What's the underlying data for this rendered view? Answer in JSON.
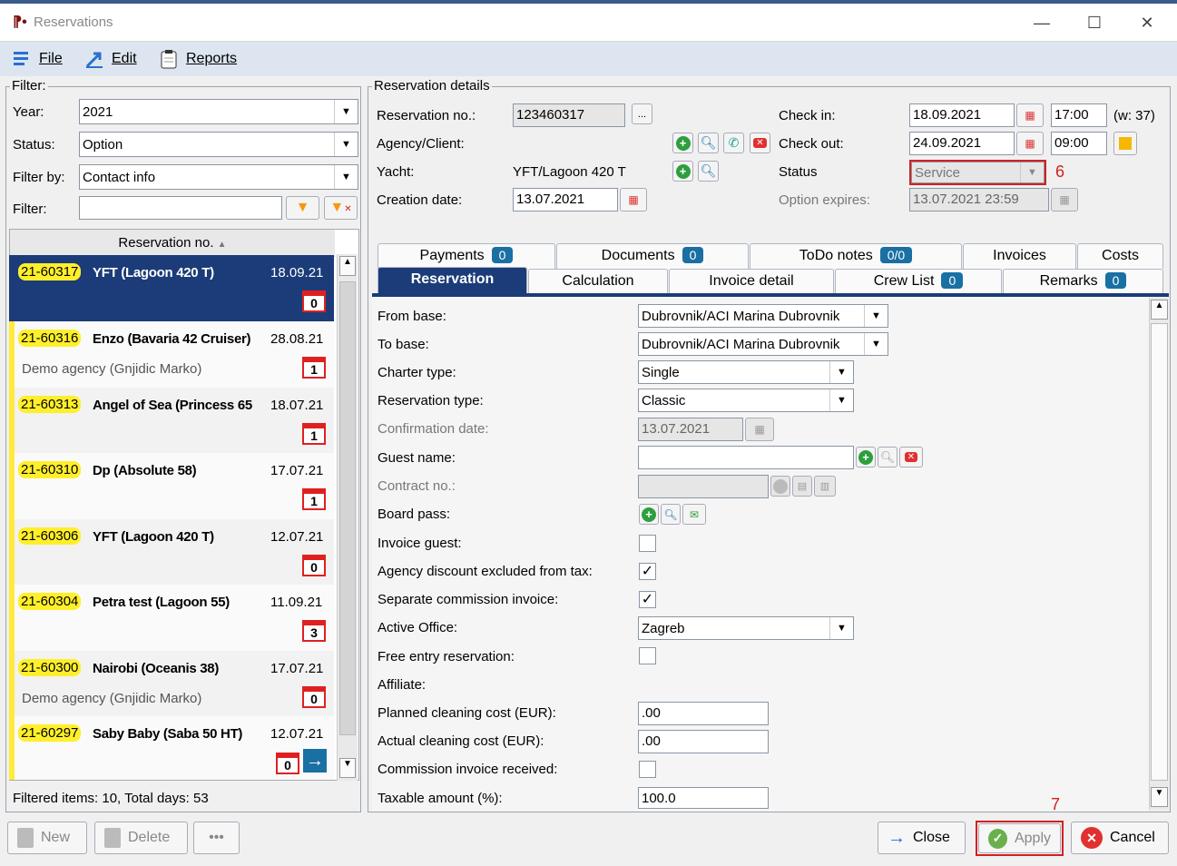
{
  "window": {
    "title": "Reservations"
  },
  "menu": {
    "file": "File",
    "edit": "Edit",
    "reports": "Reports"
  },
  "filter": {
    "group_label": "Filter:",
    "year_label": "Year:",
    "year_value": "2021",
    "status_label": "Status:",
    "status_value": "Option",
    "filterby_label": "Filter by:",
    "filterby_value": "Contact info",
    "filter_label": "Filter:",
    "filter_value": ""
  },
  "list": {
    "column_header": "Reservation no.",
    "items": [
      {
        "no": "21-60317",
        "name": "YFT (Lagoon 420 T)",
        "date": "18.09.21",
        "agency": "",
        "count": "0"
      },
      {
        "no": "21-60316",
        "name": "Enzo (Bavaria 42 Cruiser)",
        "date": "28.08.21",
        "agency": "Demo agency (Gnjidic Marko)",
        "count": "1"
      },
      {
        "no": "21-60313",
        "name": "Angel of Sea (Princess 65",
        "date": "18.07.21",
        "agency": "",
        "count": "1"
      },
      {
        "no": "21-60310",
        "name": "Dp (Absolute 58)",
        "date": "17.07.21",
        "agency": "",
        "count": "1"
      },
      {
        "no": "21-60306",
        "name": "YFT (Lagoon 420 T)",
        "date": "12.07.21",
        "agency": "",
        "count": "0"
      },
      {
        "no": "21-60304",
        "name": "Petra test (Lagoon 55)",
        "date": "11.09.21",
        "agency": "",
        "count": "3"
      },
      {
        "no": "21-60300",
        "name": "Nairobi (Oceanis 38)",
        "date": "17.07.21",
        "agency": "Demo agency (Gnjidic Marko)",
        "count": "0"
      },
      {
        "no": "21-60297",
        "name": "Saby Baby (Saba 50 HT)",
        "date": "12.07.21",
        "agency": "",
        "count": "0"
      }
    ],
    "footer": "Filtered items: 10,  Total days: 53"
  },
  "details": {
    "group_label": "Reservation details",
    "resno_label": "Reservation no.:",
    "resno_value": "123460317",
    "agency_label": "Agency/Client:",
    "yacht_label": "Yacht:",
    "yacht_value": "YFT/Lagoon 420 T",
    "created_label": "Creation date:",
    "created_value": "13.07.2021",
    "checkin_label": "Check in:",
    "checkin_date": "18.09.2021",
    "checkin_time": "17:00",
    "week": "(w: 37)",
    "checkout_label": "Check out:",
    "checkout_date": "24.09.2021",
    "checkout_time": "09:00",
    "status_label": "Status",
    "status_value": "Service",
    "option_label": "Option expires:",
    "option_value": "13.07.2021 23:59"
  },
  "tabs_top": [
    {
      "label": "Payments",
      "badge": "0"
    },
    {
      "label": "Documents",
      "badge": "0"
    },
    {
      "label": "ToDo notes",
      "badge": "0/0"
    },
    {
      "label": "Invoices",
      "badge": ""
    },
    {
      "label": "Costs",
      "badge": ""
    }
  ],
  "tabs_bottom": [
    {
      "label": "Reservation",
      "badge": ""
    },
    {
      "label": "Calculation",
      "badge": ""
    },
    {
      "label": "Invoice detail",
      "badge": ""
    },
    {
      "label": "Crew List",
      "badge": "0"
    },
    {
      "label": "Remarks",
      "badge": "0"
    }
  ],
  "form": {
    "from_base_label": "From base:",
    "from_base_value": "Dubrovnik/ACI Marina Dubrovnik",
    "to_base_label": "To base:",
    "to_base_value": "Dubrovnik/ACI Marina Dubrovnik",
    "charter_type_label": "Charter type:",
    "charter_type_value": "Single",
    "res_type_label": "Reservation type:",
    "res_type_value": "Classic",
    "confirm_label": "Confirmation date:",
    "confirm_value": "13.07.2021",
    "guest_label": "Guest name:",
    "guest_value": "",
    "contract_label": "Contract no.:",
    "contract_value": "",
    "board_label": "Board pass:",
    "invoice_guest_label": "Invoice guest:",
    "agency_disc_label": "Agency discount excluded from tax:",
    "sep_comm_label": "Separate commission invoice:",
    "office_label": "Active Office:",
    "office_value": "Zagreb",
    "free_entry_label": "Free entry reservation:",
    "affiliate_label": "Affiliate:",
    "planned_label": "Planned cleaning cost (EUR):",
    "planned_value": ".00",
    "actual_label": "Actual cleaning cost (EUR):",
    "actual_value": ".00",
    "comm_recv_label": "Commission invoice received:",
    "taxable_label": "Taxable amount (%):",
    "taxable_value": "100.0"
  },
  "buttons": {
    "new": "New",
    "delete": "Delete",
    "more": "•••",
    "close": "Close",
    "apply": "Apply",
    "cancel": "Cancel"
  },
  "annotations": {
    "six": "6",
    "seven": "7"
  }
}
